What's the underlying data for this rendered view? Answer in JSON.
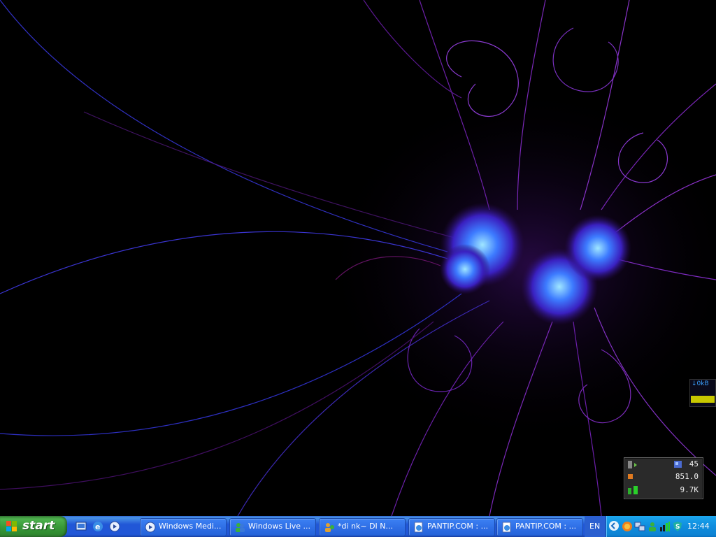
{
  "taskbar": {
    "start_label": "start",
    "quick_launch": [
      "show-desktop",
      "internet-explorer",
      "windows-media-player"
    ],
    "chevron": "»",
    "tasks": [
      {
        "label": "Windows Medi...",
        "icon": "media-player-icon"
      },
      {
        "label": "Windows Live ...",
        "icon": "messenger-icon"
      },
      {
        "label": "*di nk~   DI N...",
        "icon": "chat-icon"
      },
      {
        "label": "PANTIP.COM : ...",
        "icon": "ie-document-icon"
      },
      {
        "label": "PANTIP.COM : ...",
        "icon": "ie-document-icon"
      }
    ],
    "language": "EN",
    "clock": "12:44",
    "colors": {
      "taskbar": "#2157d7",
      "start": "#3a9a3a",
      "tray": "#0f8cdd"
    }
  },
  "widgets": {
    "network_meter": {
      "rate": "↓0kB"
    },
    "system_monitor": {
      "values": [
        "45",
        "851.0",
        "9.7K"
      ]
    }
  },
  "desktop": {
    "wallpaper": "purple-blue-fractal"
  }
}
